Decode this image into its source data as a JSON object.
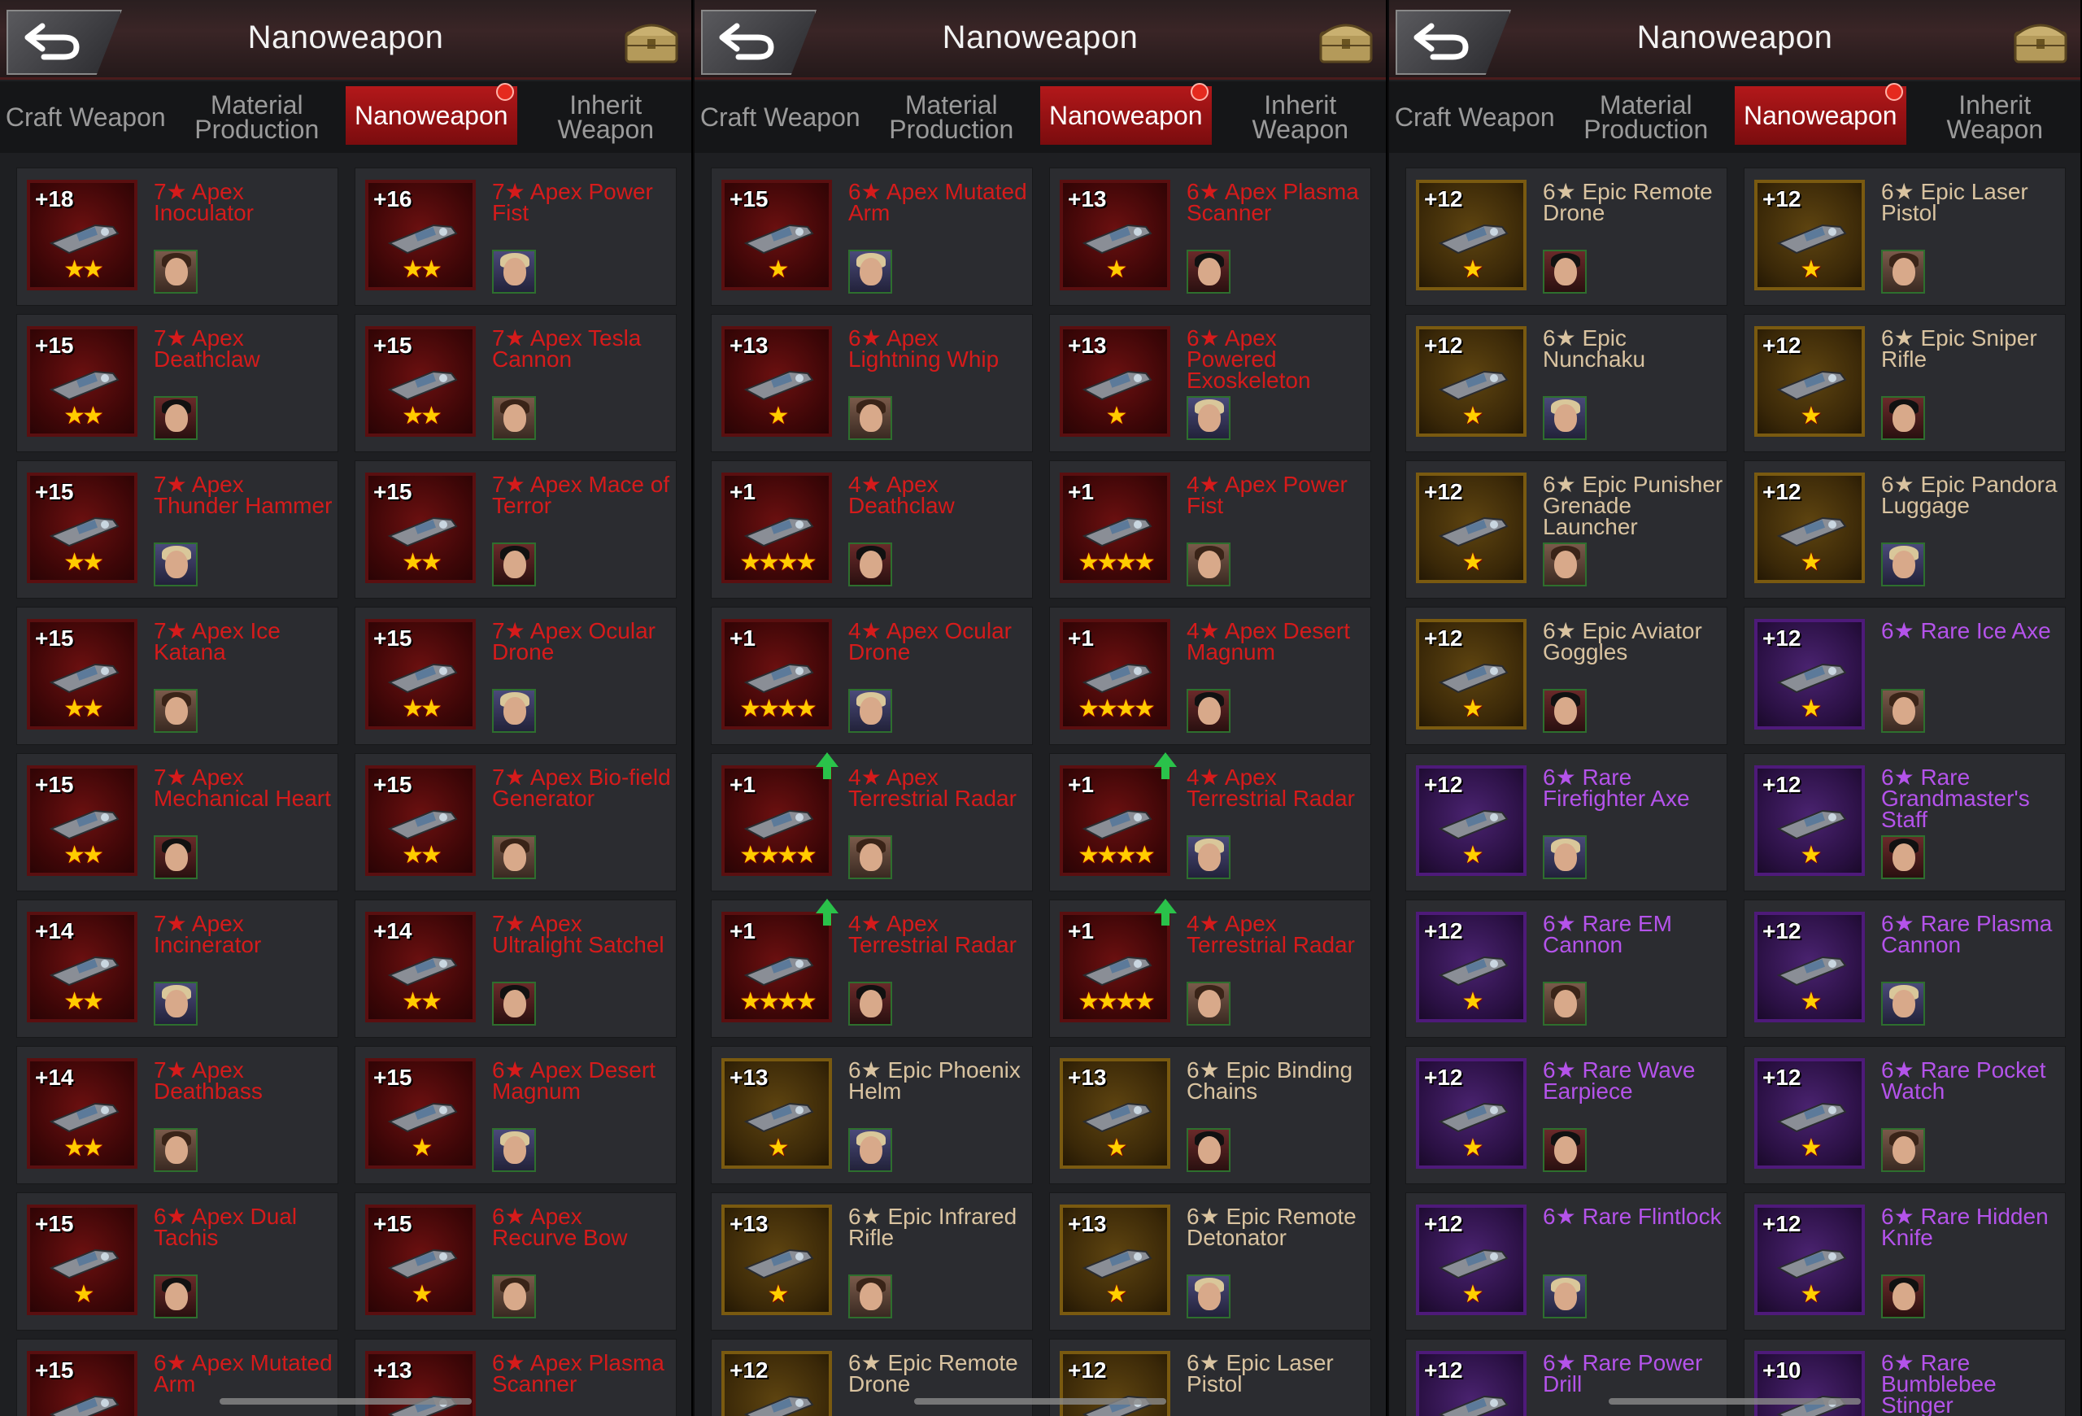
{
  "header": {
    "title": "Nanoweapon"
  },
  "tabs": [
    {
      "label": "Craft Weapon",
      "active": false,
      "badge": false
    },
    {
      "label": "Material Production",
      "active": false,
      "badge": false
    },
    {
      "label": "Nanoweapon",
      "active": true,
      "badge": true
    },
    {
      "label": "Inherit Weapon",
      "active": false,
      "badge": false
    }
  ],
  "colors": {
    "apex": "#d51b1b",
    "epic": "#d9c3a0",
    "rare": "#b453ea",
    "accent": "#b3181a"
  },
  "panels": [
    {
      "items": [
        {
          "level": "+18",
          "name": "7★ Apex Inoculator",
          "stars": 2,
          "tier": "apex",
          "upgrade": false
        },
        {
          "level": "+16",
          "name": "7★ Apex Power Fist",
          "stars": 2,
          "tier": "apex",
          "upgrade": false
        },
        {
          "level": "+15",
          "name": "7★ Apex Deathclaw",
          "stars": 2,
          "tier": "apex",
          "upgrade": false
        },
        {
          "level": "+15",
          "name": "7★ Apex Tesla Cannon",
          "stars": 2,
          "tier": "apex",
          "upgrade": false
        },
        {
          "level": "+15",
          "name": "7★ Apex Thunder Hammer",
          "stars": 2,
          "tier": "apex",
          "upgrade": false
        },
        {
          "level": "+15",
          "name": "7★ Apex Mace of Terror",
          "stars": 2,
          "tier": "apex",
          "upgrade": false
        },
        {
          "level": "+15",
          "name": "7★ Apex Ice Katana",
          "stars": 2,
          "tier": "apex",
          "upgrade": false
        },
        {
          "level": "+15",
          "name": "7★ Apex Ocular Drone",
          "stars": 2,
          "tier": "apex",
          "upgrade": false
        },
        {
          "level": "+15",
          "name": "7★ Apex Mechanical Heart",
          "stars": 2,
          "tier": "apex",
          "upgrade": false
        },
        {
          "level": "+15",
          "name": "7★ Apex Bio-field Generator",
          "stars": 2,
          "tier": "apex",
          "upgrade": false
        },
        {
          "level": "+14",
          "name": "7★ Apex Incinerator",
          "stars": 2,
          "tier": "apex",
          "upgrade": false
        },
        {
          "level": "+14",
          "name": "7★ Apex Ultralight Satchel",
          "stars": 2,
          "tier": "apex",
          "upgrade": false
        },
        {
          "level": "+14",
          "name": "7★ Apex Deathbass",
          "stars": 2,
          "tier": "apex",
          "upgrade": false
        },
        {
          "level": "+15",
          "name": "6★ Apex Desert Magnum",
          "stars": 1,
          "tier": "apex",
          "upgrade": false
        },
        {
          "level": "+15",
          "name": "6★ Apex Dual Tachis",
          "stars": 1,
          "tier": "apex",
          "upgrade": false
        },
        {
          "level": "+15",
          "name": "6★ Apex Recurve Bow",
          "stars": 1,
          "tier": "apex",
          "upgrade": false
        },
        {
          "level": "+15",
          "name": "6★ Apex Mutated Arm",
          "stars": 1,
          "tier": "apex",
          "upgrade": false
        },
        {
          "level": "+13",
          "name": "6★ Apex Plasma Scanner",
          "stars": 1,
          "tier": "apex",
          "upgrade": false
        }
      ]
    },
    {
      "items": [
        {
          "level": "+15",
          "name": "6★ Apex Mutated Arm",
          "stars": 1,
          "tier": "apex",
          "upgrade": false
        },
        {
          "level": "+13",
          "name": "6★ Apex Plasma Scanner",
          "stars": 1,
          "tier": "apex",
          "upgrade": false
        },
        {
          "level": "+13",
          "name": "6★ Apex Lightning Whip",
          "stars": 1,
          "tier": "apex",
          "upgrade": false
        },
        {
          "level": "+13",
          "name": "6★ Apex Powered Exoskeleton",
          "stars": 1,
          "tier": "apex",
          "upgrade": false
        },
        {
          "level": "+1",
          "name": "4★ Apex Deathclaw",
          "stars": 4,
          "tier": "apex",
          "upgrade": false
        },
        {
          "level": "+1",
          "name": "4★ Apex Power Fist",
          "stars": 4,
          "tier": "apex",
          "upgrade": false
        },
        {
          "level": "+1",
          "name": "4★ Apex Ocular Drone",
          "stars": 4,
          "tier": "apex",
          "upgrade": false
        },
        {
          "level": "+1",
          "name": "4★ Apex Desert Magnum",
          "stars": 4,
          "tier": "apex",
          "upgrade": false
        },
        {
          "level": "+1",
          "name": "4★ Apex Terrestrial Radar",
          "stars": 4,
          "tier": "apex",
          "upgrade": true
        },
        {
          "level": "+1",
          "name": "4★ Apex Terrestrial Radar",
          "stars": 4,
          "tier": "apex",
          "upgrade": true
        },
        {
          "level": "+1",
          "name": "4★ Apex Terrestrial Radar",
          "stars": 4,
          "tier": "apex",
          "upgrade": true
        },
        {
          "level": "+1",
          "name": "4★ Apex Terrestrial Radar",
          "stars": 4,
          "tier": "apex",
          "upgrade": true
        },
        {
          "level": "+13",
          "name": "6★ Epic Phoenix Helm",
          "stars": 1,
          "tier": "epic",
          "upgrade": false
        },
        {
          "level": "+13",
          "name": "6★ Epic Binding Chains",
          "stars": 1,
          "tier": "epic",
          "upgrade": false
        },
        {
          "level": "+13",
          "name": "6★ Epic Infrared Rifle",
          "stars": 1,
          "tier": "epic",
          "upgrade": false
        },
        {
          "level": "+13",
          "name": "6★ Epic Remote Detonator",
          "stars": 1,
          "tier": "epic",
          "upgrade": false
        },
        {
          "level": "+12",
          "name": "6★ Epic Remote Drone",
          "stars": 1,
          "tier": "epic",
          "upgrade": false
        },
        {
          "level": "+12",
          "name": "6★ Epic Laser Pistol",
          "stars": 1,
          "tier": "epic",
          "upgrade": false
        }
      ]
    },
    {
      "items": [
        {
          "level": "+12",
          "name": "6★ Epic Remote Drone",
          "stars": 1,
          "tier": "epic",
          "upgrade": false
        },
        {
          "level": "+12",
          "name": "6★ Epic Laser Pistol",
          "stars": 1,
          "tier": "epic",
          "upgrade": false
        },
        {
          "level": "+12",
          "name": "6★ Epic Nunchaku",
          "stars": 1,
          "tier": "epic",
          "upgrade": false
        },
        {
          "level": "+12",
          "name": "6★ Epic Sniper Rifle",
          "stars": 1,
          "tier": "epic",
          "upgrade": false
        },
        {
          "level": "+12",
          "name": "6★ Epic Punisher Grenade Launcher",
          "stars": 1,
          "tier": "epic",
          "upgrade": false
        },
        {
          "level": "+12",
          "name": "6★ Epic Pandora Luggage",
          "stars": 1,
          "tier": "epic",
          "upgrade": false
        },
        {
          "level": "+12",
          "name": "6★ Epic Aviator Goggles",
          "stars": 1,
          "tier": "epic",
          "upgrade": false
        },
        {
          "level": "+12",
          "name": "6★ Rare Ice Axe",
          "stars": 1,
          "tier": "rare",
          "upgrade": false
        },
        {
          "level": "+12",
          "name": "6★ Rare Firefighter Axe",
          "stars": 1,
          "tier": "rare",
          "upgrade": false
        },
        {
          "level": "+12",
          "name": "6★ Rare Grandmaster's Staff",
          "stars": 1,
          "tier": "rare",
          "upgrade": false
        },
        {
          "level": "+12",
          "name": "6★ Rare EM Cannon",
          "stars": 1,
          "tier": "rare",
          "upgrade": false
        },
        {
          "level": "+12",
          "name": "6★ Rare Plasma Cannon",
          "stars": 1,
          "tier": "rare",
          "upgrade": false
        },
        {
          "level": "+12",
          "name": "6★ Rare Wave Earpiece",
          "stars": 1,
          "tier": "rare",
          "upgrade": false
        },
        {
          "level": "+12",
          "name": "6★ Rare Pocket Watch",
          "stars": 1,
          "tier": "rare",
          "upgrade": false
        },
        {
          "level": "+12",
          "name": "6★ Rare Flintlock",
          "stars": 1,
          "tier": "rare",
          "upgrade": false
        },
        {
          "level": "+12",
          "name": "6★ Rare Hidden Knife",
          "stars": 1,
          "tier": "rare",
          "upgrade": false
        },
        {
          "level": "+12",
          "name": "6★ Rare Power Drill",
          "stars": 1,
          "tier": "rare",
          "upgrade": false
        },
        {
          "level": "+10",
          "name": "6★ Rare Bumblebee Stinger",
          "stars": 1,
          "tier": "rare",
          "upgrade": false
        }
      ]
    }
  ]
}
